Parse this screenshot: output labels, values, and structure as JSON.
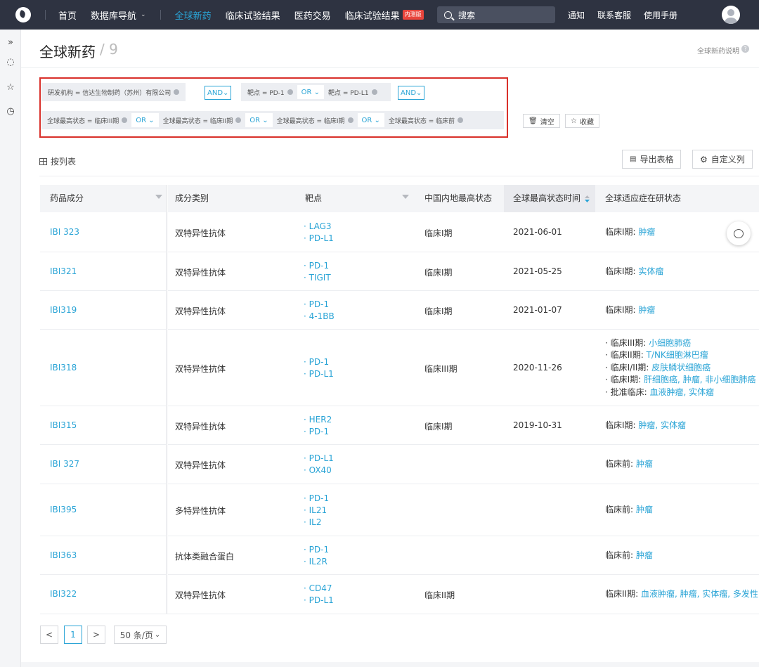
{
  "nav": {
    "home": "首页",
    "db_nav": "数据库导航",
    "global_new_drugs": "全球新药",
    "clinical_results": "临床试验结果",
    "pharma_deals": "医药交易",
    "clinical_results_beta": "临床试验结果",
    "beta_badge": "内测版",
    "search_placeholder": "搜索",
    "notify": "通知",
    "support": "联系客服",
    "manual": "使用手册"
  },
  "page": {
    "title": "全球新药",
    "count": "/ 9",
    "help": "全球新药说明"
  },
  "filters": {
    "row1": [
      {
        "label": "研发机构 = 信达生物制药（苏州）有限公司"
      },
      {
        "logic": "AND"
      },
      {
        "label": "靶点 = PD-1"
      },
      {
        "logic": "OR"
      },
      {
        "label": "靶点 = PD-L1"
      },
      {
        "logic": "AND"
      }
    ],
    "row2": [
      {
        "label": "全球最高状态 = 临床III期"
      },
      {
        "logic": "OR"
      },
      {
        "label": "全球最高状态 = 临床II期"
      },
      {
        "logic": "OR"
      },
      {
        "label": "全球最高状态 = 临床I期"
      },
      {
        "logic": "OR"
      },
      {
        "label": "全球最高状态 = 临床前"
      }
    ],
    "clear": "清空",
    "save": "收藏"
  },
  "toolbar": {
    "list_view": "按列表",
    "export": "导出表格",
    "custom_cols": "自定义列"
  },
  "table": {
    "columns": [
      "药品成分",
      "成分类别",
      "靶点",
      "中国内地最高状态",
      "全球最高状态时间",
      "全球适应症在研状态"
    ],
    "rows": [
      {
        "name": "IBI 323",
        "category": "双特异性抗体",
        "targets": [
          "LAG3",
          "PD-L1"
        ],
        "cn_status": "临床I期",
        "date": "2021-06-01",
        "indications": [
          {
            "phase": "临床I期: ",
            "items": [
              "肿瘤"
            ]
          }
        ]
      },
      {
        "name": "IBI321",
        "category": "双特异性抗体",
        "targets": [
          "PD-1",
          "TIGIT"
        ],
        "cn_status": "临床I期",
        "date": "2021-05-25",
        "indications": [
          {
            "phase": "临床I期: ",
            "items": [
              "实体瘤"
            ]
          }
        ]
      },
      {
        "name": "IBI319",
        "category": "双特异性抗体",
        "targets": [
          "PD-1",
          "4-1BB"
        ],
        "cn_status": "临床I期",
        "date": "2021-01-07",
        "indications": [
          {
            "phase": "临床I期: ",
            "items": [
              "肿瘤"
            ]
          }
        ]
      },
      {
        "name": "IBI318",
        "category": "双特异性抗体",
        "targets": [
          "PD-1",
          "PD-L1"
        ],
        "cn_status": "临床III期",
        "date": "2020-11-26",
        "indications": [
          {
            "phase": "· 临床III期: ",
            "items": [
              "小细胞肺癌"
            ]
          },
          {
            "phase": "· 临床II期: ",
            "items": [
              "T/NK细胞淋巴瘤"
            ]
          },
          {
            "phase": "· 临床I/II期: ",
            "items": [
              "皮肤鳞状细胞癌"
            ]
          },
          {
            "phase": "· 临床I期: ",
            "items": [
              "肝细胞癌",
              "肿瘤",
              "非小细胞肺癌"
            ]
          },
          {
            "phase": "· 批准临床: ",
            "items": [
              "血液肿瘤",
              "实体瘤"
            ]
          }
        ]
      },
      {
        "name": "IBI315",
        "category": "双特异性抗体",
        "targets": [
          "HER2",
          "PD-1"
        ],
        "cn_status": "临床I期",
        "date": "2019-10-31",
        "indications": [
          {
            "phase": "临床I期: ",
            "items": [
              "肿瘤",
              "实体瘤"
            ]
          }
        ]
      },
      {
        "name": "IBI 327",
        "category": "双特异性抗体",
        "targets": [
          "PD-L1",
          "OX40"
        ],
        "cn_status": "",
        "date": "",
        "indications": [
          {
            "phase": "临床前: ",
            "items": [
              "肿瘤"
            ]
          }
        ]
      },
      {
        "name": "IBI395",
        "category": "多特异性抗体",
        "targets": [
          "PD-1",
          "IL21",
          "IL2"
        ],
        "cn_status": "",
        "date": "",
        "indications": [
          {
            "phase": "临床前: ",
            "items": [
              "肿瘤"
            ]
          }
        ]
      },
      {
        "name": "IBI363",
        "category": "抗体类融合蛋白",
        "targets": [
          "PD-1",
          "IL2R"
        ],
        "cn_status": "",
        "date": "",
        "indications": [
          {
            "phase": "临床前: ",
            "items": [
              "肿瘤"
            ]
          }
        ]
      },
      {
        "name": "IBI322",
        "category": "双特异性抗体",
        "targets": [
          "CD47",
          "PD-L1"
        ],
        "cn_status": "临床II期",
        "date": "",
        "indications": [
          {
            "phase": "临床II期: ",
            "items": [
              "血液肿瘤",
              "肿瘤",
              "实体瘤",
              "多发性"
            ]
          }
        ]
      }
    ]
  },
  "pagination": {
    "prev": "<",
    "page": "1",
    "next": ">",
    "page_size": "50 条/页"
  },
  "colors": {
    "nav_bg": "#2e3341",
    "accent": "#2aa4d6",
    "highlight_border": "#d9302a"
  }
}
